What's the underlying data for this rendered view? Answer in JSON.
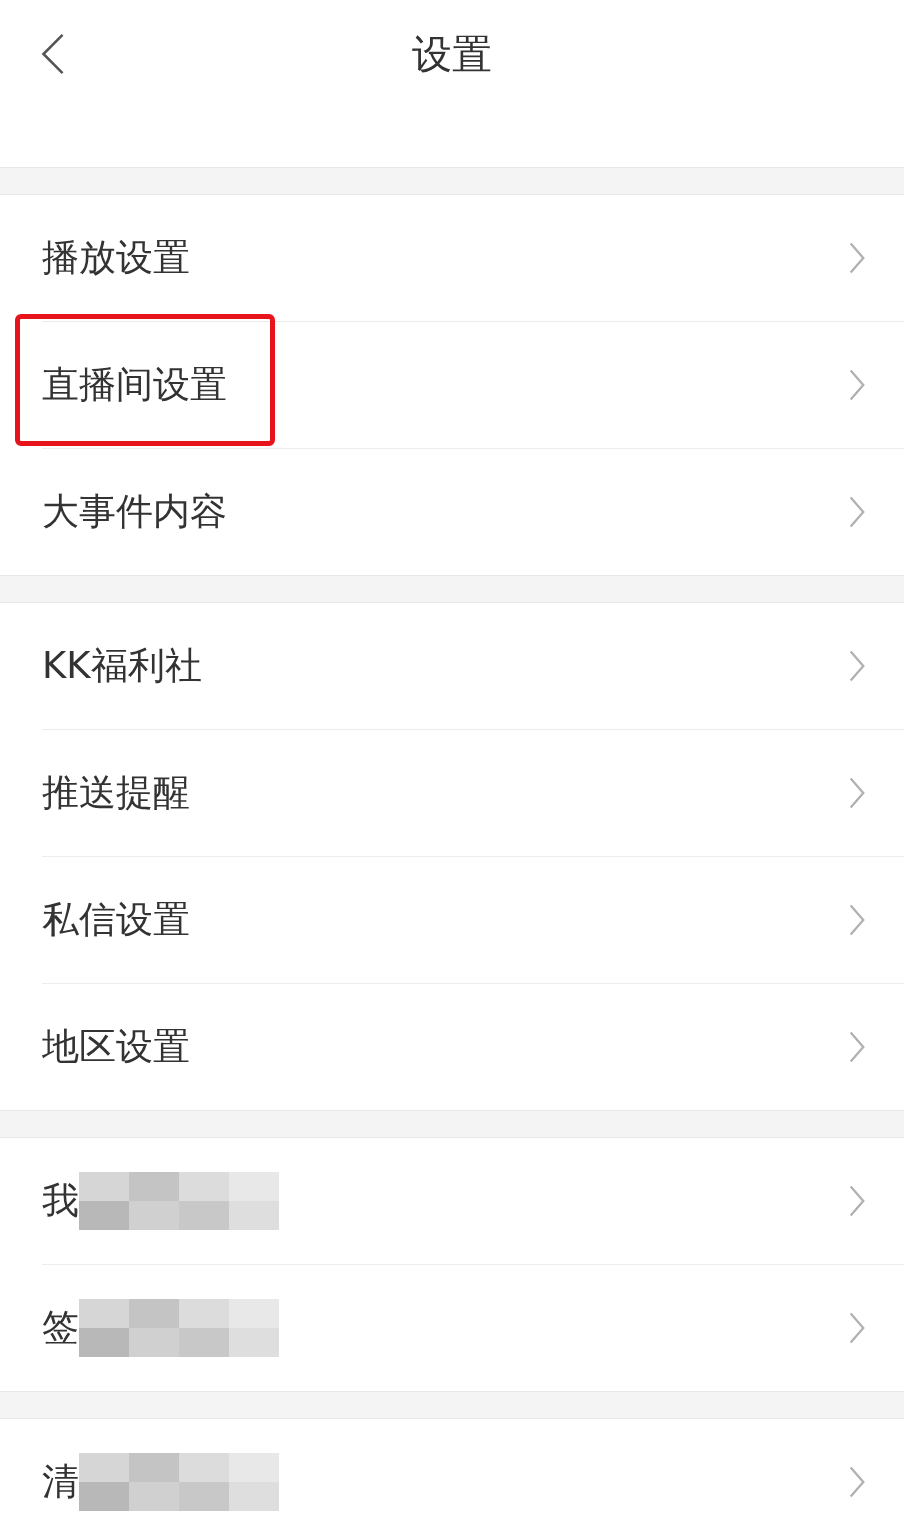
{
  "header": {
    "title": "设置"
  },
  "groups": [
    {
      "items": [
        {
          "label": "播放设置",
          "highlighted": false
        },
        {
          "label": "直播间设置",
          "highlighted": true
        },
        {
          "label": "大事件内容",
          "highlighted": false
        }
      ]
    },
    {
      "items": [
        {
          "label": "KK福利社",
          "highlighted": false
        },
        {
          "label": "推送提醒",
          "highlighted": false
        },
        {
          "label": "私信设置",
          "highlighted": false
        },
        {
          "label": "地区设置",
          "highlighted": false
        }
      ]
    },
    {
      "items": [
        {
          "label": "我",
          "highlighted": false,
          "redacted": true
        },
        {
          "label": "签",
          "highlighted": false,
          "redacted": true
        }
      ]
    },
    {
      "items": [
        {
          "label": "清",
          "highlighted": false,
          "redacted": true
        }
      ]
    }
  ]
}
